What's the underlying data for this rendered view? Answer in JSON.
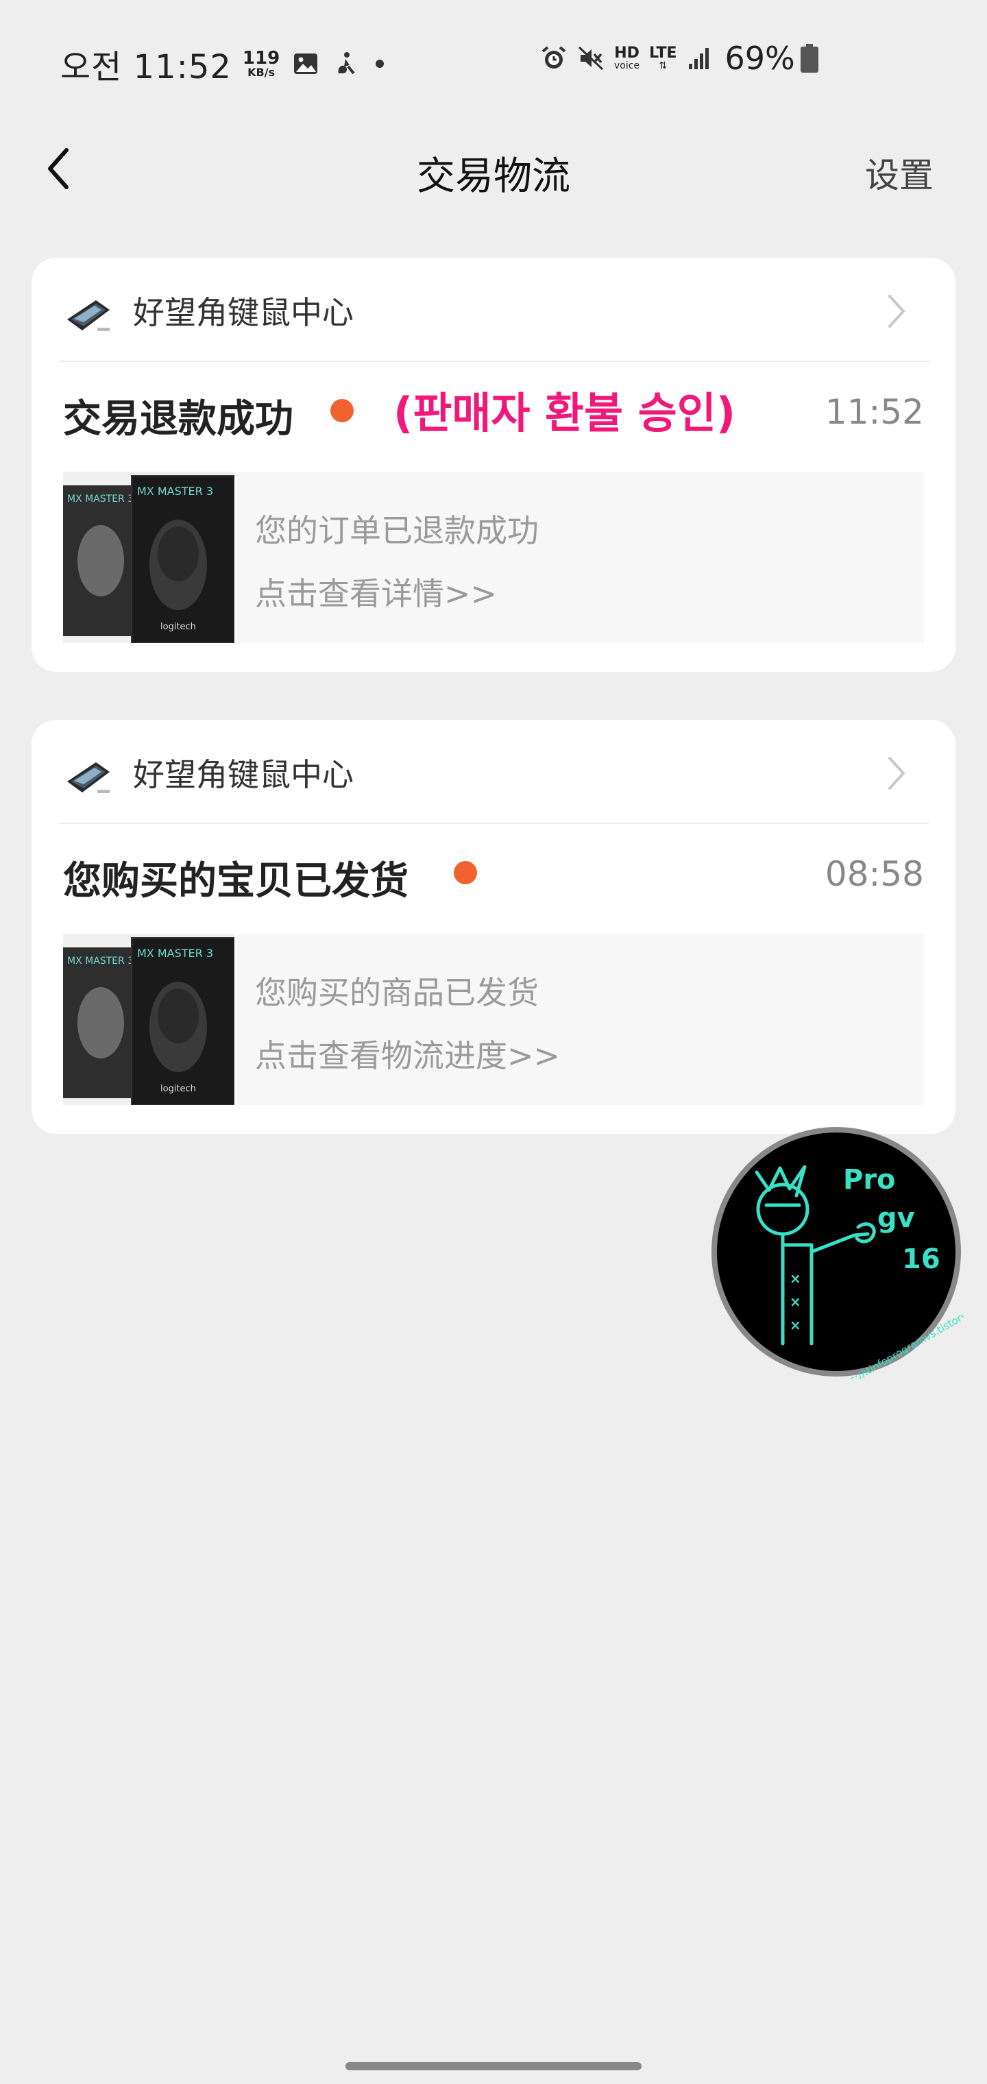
{
  "status_bar": {
    "time": "오전 11:52",
    "net_speed_value": "119",
    "net_speed_unit": "KB/s",
    "hd_label": "HD",
    "hd_sub": "voice",
    "lte_label": "LTE",
    "battery": "69%"
  },
  "header": {
    "title": "交易物流",
    "settings": "设置"
  },
  "messages": [
    {
      "shop_name": "好望角键鼠中心",
      "title": "交易退款成功",
      "annotation": "(판매자 환불 승인)",
      "time": "11:52",
      "line1": "您的订单已退款成功",
      "line2": "点击查看详情>>"
    },
    {
      "shop_name": "好望角键鼠中心",
      "title": "您购买的宝贝已发货",
      "time": "08:58",
      "line1": "您购买的商品已发货",
      "line2": "点击查看物流进度>>"
    }
  ],
  "product_image": {
    "box_text": "MX MASTER 3",
    "brand": "logitech"
  },
  "watermark": {
    "line1": "Pro",
    "line2": "gv",
    "line3": "16",
    "url": "https://itinfoprogramvs.tistory.com"
  },
  "colors": {
    "accent_dot": "#f06230",
    "annotation": "#f0187a",
    "watermark_line": "#38e0c8"
  }
}
